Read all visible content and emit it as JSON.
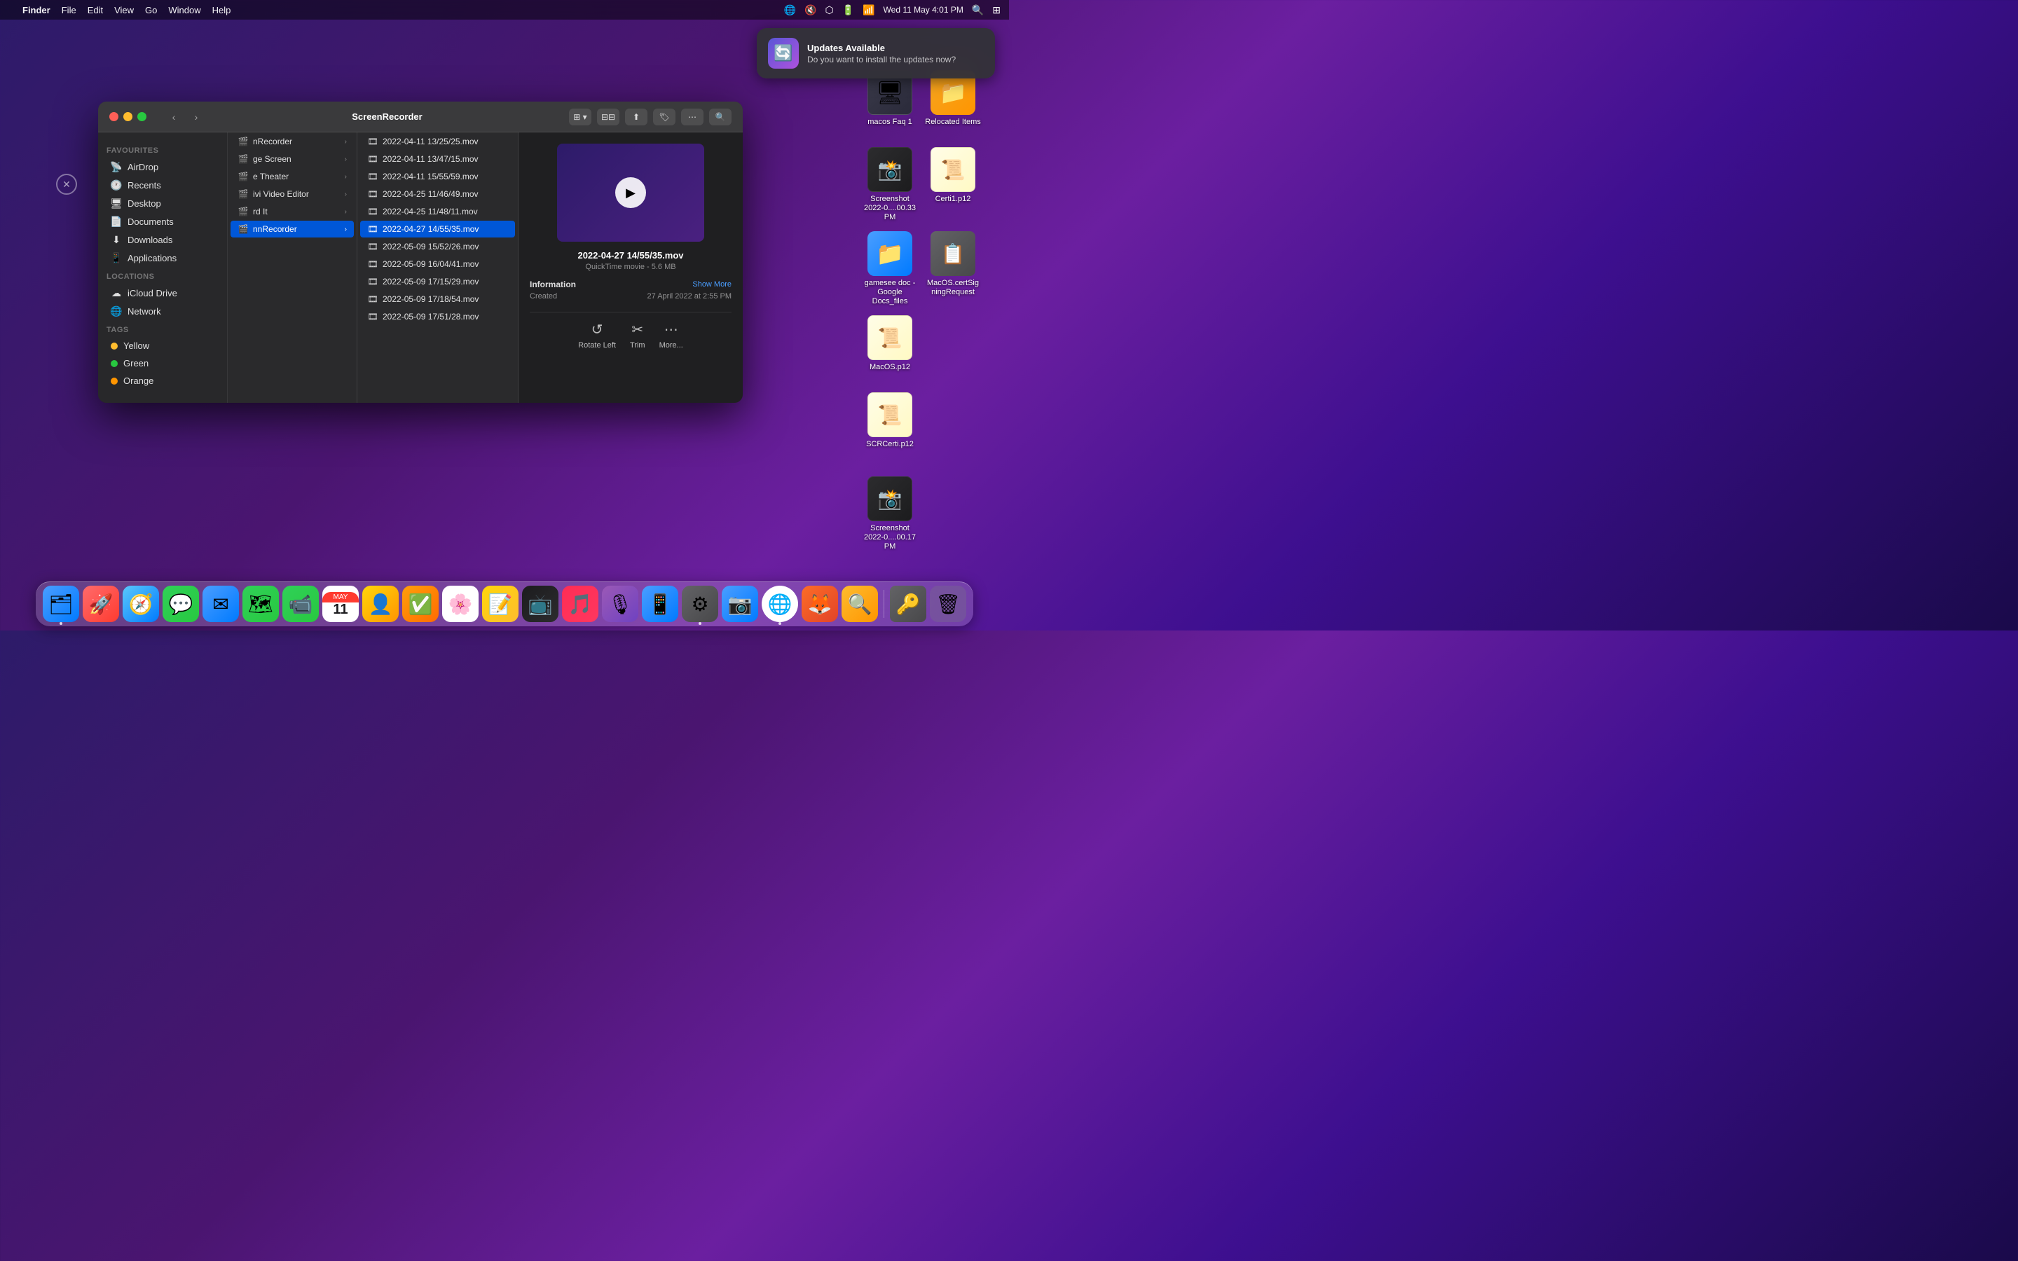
{
  "menubar": {
    "apple_label": "",
    "app_name": "Finder",
    "menus": [
      "File",
      "Edit",
      "View",
      "Go",
      "Window",
      "Help"
    ],
    "date_time": "Wed 11 May  4:01 PM",
    "status_icons": [
      "globe",
      "mute",
      "bluetooth",
      "battery",
      "wifi",
      "search",
      "control"
    ]
  },
  "notification": {
    "title": "Updates Available",
    "body": "Do you want to install the updates now?",
    "icon": "🔄"
  },
  "finder": {
    "title": "ScreenRecorder",
    "sidebar": {
      "favourites_label": "Favourites",
      "favourites": [
        {
          "name": "AirDrop",
          "icon": "📡"
        },
        {
          "name": "Recents",
          "icon": "🕐"
        },
        {
          "name": "Desktop",
          "icon": "🖥"
        },
        {
          "name": "Documents",
          "icon": "📄"
        },
        {
          "name": "Downloads",
          "icon": "⬇"
        },
        {
          "name": "Applications",
          "icon": "📱"
        }
      ],
      "locations_label": "Locations",
      "locations": [
        {
          "name": "iCloud Drive",
          "icon": "☁"
        },
        {
          "name": "Network",
          "icon": "🌐"
        }
      ],
      "tags_label": "Tags",
      "tags": [
        {
          "name": "Yellow",
          "color": "#febc2e"
        },
        {
          "name": "Green",
          "color": "#28c840"
        },
        {
          "name": "Orange",
          "color": "#ff9500"
        }
      ]
    },
    "column1": [
      {
        "name": "nRecorder",
        "has_arrow": true
      },
      {
        "name": "ge Screen",
        "has_arrow": true
      },
      {
        "name": "e Theater",
        "has_arrow": true
      },
      {
        "name": "ivi Video Editor",
        "has_arrow": true
      },
      {
        "name": "rd It",
        "has_arrow": true
      },
      {
        "name": "nnRecorder",
        "has_arrow": true,
        "selected": true
      }
    ],
    "files": [
      {
        "name": "2022-04-11 13/25/25.mov"
      },
      {
        "name": "2022-04-11 13/47/15.mov"
      },
      {
        "name": "2022-04-11 15/55/59.mov"
      },
      {
        "name": "2022-04-25 11/46/49.mov"
      },
      {
        "name": "2022-04-25 11/48/11.mov"
      },
      {
        "name": "2022-04-27 14/55/35.mov",
        "selected": true
      },
      {
        "name": "2022-05-09 15/52/26.mov"
      },
      {
        "name": "2022-05-09 16/04/41.mov"
      },
      {
        "name": "2022-05-09 17/15/29.mov"
      },
      {
        "name": "2022-05-09 17/18/54.mov"
      },
      {
        "name": "2022-05-09 17/51/28.mov"
      }
    ],
    "preview": {
      "filename": "2022-04-27 14/55/35.mov",
      "type": "QuickTime movie",
      "size": "5.6 MB",
      "info_label": "Information",
      "show_more": "Show More",
      "created_label": "Created",
      "created_value": "27 April 2022 at 2:55 PM",
      "actions": [
        {
          "name": "Rotate Left",
          "icon": "↺"
        },
        {
          "name": "Trim",
          "icon": "✂"
        },
        {
          "name": "More...",
          "icon": "⋯"
        }
      ]
    }
  },
  "desktop_items": [
    {
      "id": "macos-faq",
      "label": "macos Faq 1",
      "icon_color": "#4a9eff",
      "icon_type": "screenshot"
    },
    {
      "id": "relocated-items",
      "label": "Relocated Items",
      "icon_color": "#8e8e93",
      "icon_type": "folder"
    },
    {
      "id": "screenshot",
      "label": "Screenshot 2022-0....00.33 PM",
      "icon_color": "#2c2c2e",
      "icon_type": "screenshot"
    },
    {
      "id": "certi1",
      "label": "Certi1.p12",
      "icon_color": "#f5a623",
      "icon_type": "cert"
    },
    {
      "id": "gamesee-doc",
      "label": "gamesee doc - Google Docs_files",
      "icon_color": "#4a9eff",
      "icon_type": "folder"
    },
    {
      "id": "macos-certsigning",
      "label": "MacOS.certSigningRequest",
      "icon_color": "#8e8e93",
      "icon_type": "doc"
    },
    {
      "id": "macos-p12",
      "label": "MacOS.p12",
      "icon_color": "#f5a623",
      "icon_type": "cert"
    },
    {
      "id": "scr-certi",
      "label": "SCRCerti.p12",
      "icon_color": "#f5a623",
      "icon_type": "cert"
    },
    {
      "id": "screenshot2",
      "label": "Screenshot 2022-0....00.17 PM",
      "icon_color": "#2c2c2e",
      "icon_type": "screenshot"
    }
  ],
  "dock": {
    "items": [
      {
        "id": "finder",
        "icon": "🗂",
        "color": "#4a9eff",
        "has_dot": true
      },
      {
        "id": "launchpad",
        "icon": "🚀",
        "color": "#ff6b6b",
        "has_dot": false
      },
      {
        "id": "safari",
        "icon": "🧭",
        "color": "#4a9eff",
        "has_dot": false
      },
      {
        "id": "messages",
        "icon": "💬",
        "color": "#28c840",
        "has_dot": false
      },
      {
        "id": "mail",
        "icon": "✉",
        "color": "#4a9eff",
        "has_dot": false
      },
      {
        "id": "maps",
        "icon": "🗺",
        "color": "#28c840",
        "has_dot": false
      },
      {
        "id": "facetime",
        "icon": "📹",
        "color": "#28c840",
        "has_dot": false
      },
      {
        "id": "calendar",
        "icon": "📅",
        "color": "#ff3b30",
        "has_dot": false
      },
      {
        "id": "contacts",
        "icon": "👤",
        "color": "#f5a623",
        "has_dot": false
      },
      {
        "id": "reminders",
        "icon": "✅",
        "color": "#ff9500",
        "has_dot": false
      },
      {
        "id": "photos",
        "icon": "🌸",
        "color": "#ff6b6b",
        "has_dot": false
      },
      {
        "id": "notes",
        "icon": "📝",
        "color": "#febc2e",
        "has_dot": false
      },
      {
        "id": "appletv",
        "icon": "📺",
        "color": "#1c1c1e",
        "has_dot": false
      },
      {
        "id": "music",
        "icon": "🎵",
        "color": "#ff2d55",
        "has_dot": false
      },
      {
        "id": "podcasts",
        "icon": "🎙",
        "color": "#9b59b6",
        "has_dot": false
      },
      {
        "id": "appstore",
        "icon": "📱",
        "color": "#4a9eff",
        "has_dot": false
      },
      {
        "id": "systemprefs",
        "icon": "⚙",
        "color": "#636366",
        "has_dot": true
      },
      {
        "id": "zoom",
        "icon": "📷",
        "color": "#4a9eff",
        "has_dot": false
      },
      {
        "id": "chrome",
        "icon": "🌐",
        "color": "#4a9eff",
        "has_dot": true
      },
      {
        "id": "gitlab",
        "icon": "🦊",
        "color": "#e24329",
        "has_dot": false
      },
      {
        "id": "proxyman",
        "icon": "🔍",
        "color": "#febc2e",
        "has_dot": false
      },
      {
        "id": "keychain",
        "icon": "🔑",
        "color": "#636366",
        "has_dot": false
      },
      {
        "id": "trash",
        "icon": "🗑",
        "color": "#636366",
        "has_dot": false
      }
    ]
  }
}
